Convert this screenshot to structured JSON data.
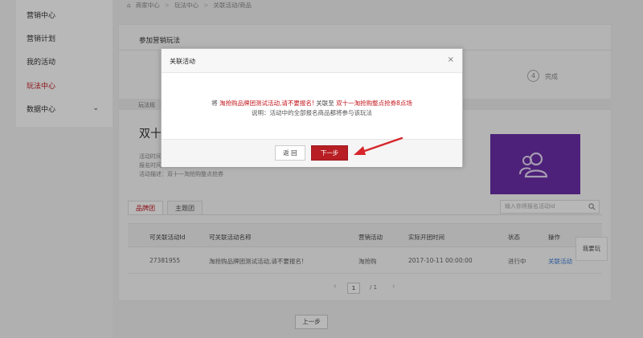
{
  "sidebar": {
    "items": [
      {
        "label": "营销中心"
      },
      {
        "label": "营销计划"
      },
      {
        "label": "我的活动"
      },
      {
        "label": "玩法中心"
      },
      {
        "label": "数据中心"
      }
    ],
    "active_item": "玩法中心"
  },
  "breadcrumb": {
    "home": "商家中心",
    "level2": "玩法中心",
    "current": "关联活动/商品"
  },
  "main": {
    "title": "参加营销玩法",
    "step_number": "4",
    "step_label": "完成",
    "band_text": "玩法规",
    "activity_title": "双十",
    "meta": {
      "line1": "活动时间",
      "line2": "报名时间",
      "line3": "活动描述：双十一淘抢购整点抢券"
    }
  },
  "tabs": [
    {
      "label": "品牌团",
      "active": true
    },
    {
      "label": "主题团",
      "active": false
    }
  ],
  "search": {
    "placeholder": "输入你将报名活动id"
  },
  "table": {
    "headers": [
      "可关联活动Id",
      "可关联活动名称",
      "营销活动",
      "实际开团时间",
      "状态",
      "操作"
    ],
    "rows": [
      {
        "id": "27381955",
        "name": "淘抢购品牌团测试活动,请不要报名!",
        "marketing": "淘抢购",
        "start_time": "2017-10-11 00:00:00",
        "status": "进行中",
        "action": "关联活动"
      }
    ]
  },
  "float_tab": {
    "label": "我要玩"
  },
  "pagination": {
    "current": "1",
    "total": "/  1",
    "prev": "‹",
    "next": "›"
  },
  "prev_step_button": "上一步",
  "modal": {
    "title": "关联活动",
    "line1_prefix": "将",
    "line1_activity": "淘抢购品牌团测试活动,请不要报名!",
    "line1_middle": "关联至",
    "line1_target": "双十一淘抢购整点抢券8点场",
    "line2": "说明：活动中的全部报名商品都将参与该玩法",
    "back_label": "返 回",
    "next_label": "下一步",
    "close_glyph": "×"
  },
  "colors": {
    "accent_red": "#c4161c",
    "button_red": "#b71f24",
    "purple_card": "#6b2fa8",
    "link_blue": "#3a7bd5"
  }
}
